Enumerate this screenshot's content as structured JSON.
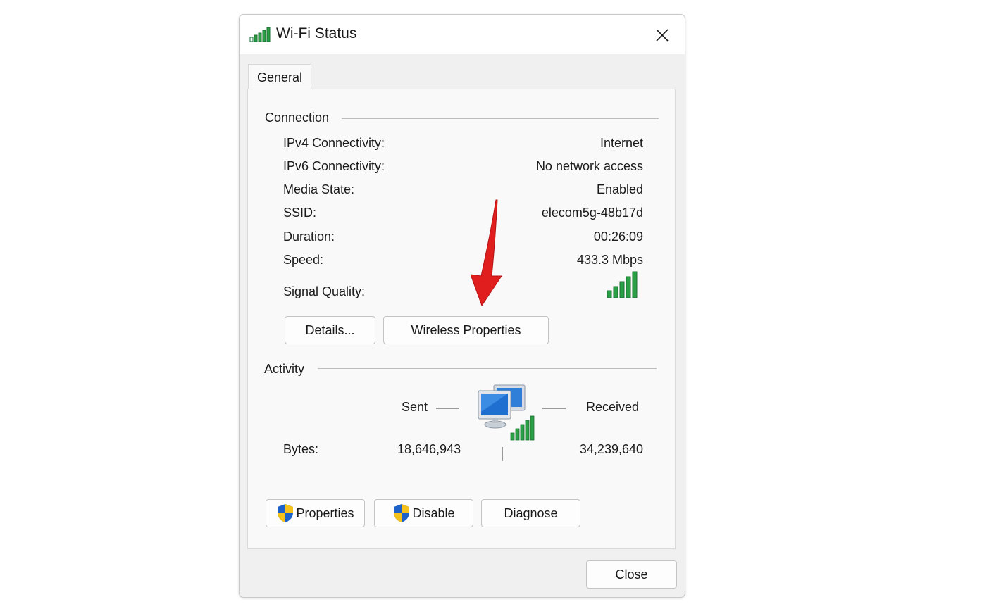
{
  "window": {
    "title": "Wi-Fi Status",
    "icons": {
      "title": "wifi-signal-icon",
      "close": "close-icon"
    }
  },
  "tabs": [
    {
      "label": "General",
      "selected": true
    }
  ],
  "connection": {
    "heading": "Connection",
    "rows": [
      {
        "label": "IPv4 Connectivity:",
        "value": "Internet"
      },
      {
        "label": "IPv6 Connectivity:",
        "value": "No network access"
      },
      {
        "label": "Media State:",
        "value": "Enabled"
      },
      {
        "label": "SSID:",
        "value": "elecom5g-48b17d"
      },
      {
        "label": "Duration:",
        "value": "00:26:09"
      },
      {
        "label": "Speed:",
        "value": "433.3 Mbps"
      }
    ],
    "signal_label": "Signal Quality:",
    "signal_bars": 5,
    "signal_bars_filled": 5,
    "buttons": {
      "details": "Details...",
      "wireless_properties": "Wireless Properties"
    }
  },
  "activity": {
    "heading": "Activity",
    "sent_label": "Sent",
    "received_label": "Received",
    "bytes_label": "Bytes:",
    "bytes_sent": "18,646,943",
    "bytes_received": "34,239,640",
    "icon": "network-computers-icon"
  },
  "bottom_buttons": {
    "properties": "Properties",
    "disable": "Disable",
    "diagnose": "Diagnose",
    "shield_icon": "uac-shield-icon"
  },
  "close_button": "Close",
  "annotation": {
    "icon": "red-arrow-icon",
    "color": "#e01e1e"
  },
  "colors": {
    "signal_green": "#1e9a3a",
    "window_bg": "#f0f0f0",
    "panel_bg": "#f9f9f9"
  }
}
